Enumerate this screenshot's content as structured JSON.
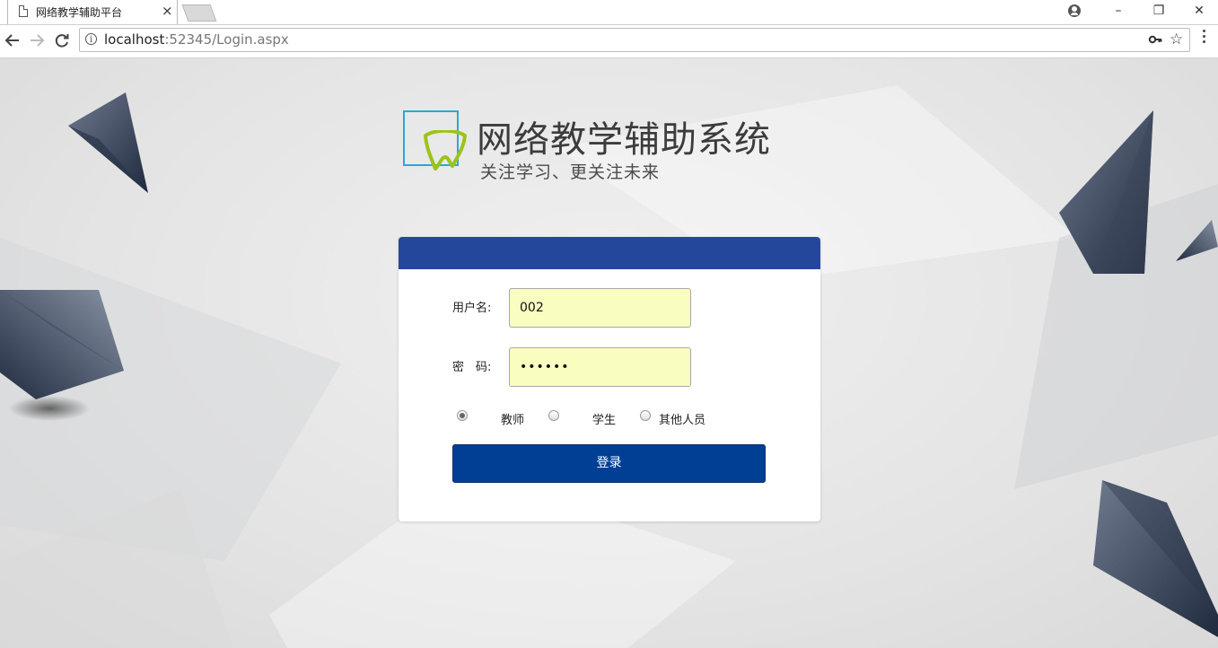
{
  "browser": {
    "tab_title": "网络教学辅助平台",
    "tab_close": "×",
    "url_host": "localhost",
    "url_path": ":52345/Login.aspx",
    "window_controls": [
      "–",
      "❐",
      "✕"
    ],
    "icons": [
      "page-icon",
      "profile-icon",
      "back-icon",
      "forward-icon",
      "reload-icon",
      "info-icon",
      "key-icon",
      "star-icon",
      "menu-icon"
    ]
  },
  "header": {
    "title": "网络教学辅助系统",
    "subtitle": "关注学习、更关注未来"
  },
  "form": {
    "username_label": "用户名:",
    "username_value": "002",
    "password_label": "密　码:",
    "password_value": "••••••",
    "roles": [
      {
        "label": "教师",
        "checked": true
      },
      {
        "label": "学生",
        "checked": false
      },
      {
        "label": "其他人员",
        "checked": false
      }
    ],
    "login_label": "登录"
  },
  "colors": {
    "card_header": "#24479b",
    "login_button": "#003f93",
    "input_bg": "#fafdc0",
    "logo_frame": "#2aa8d8",
    "logo_tooth": "#9cc31a"
  }
}
